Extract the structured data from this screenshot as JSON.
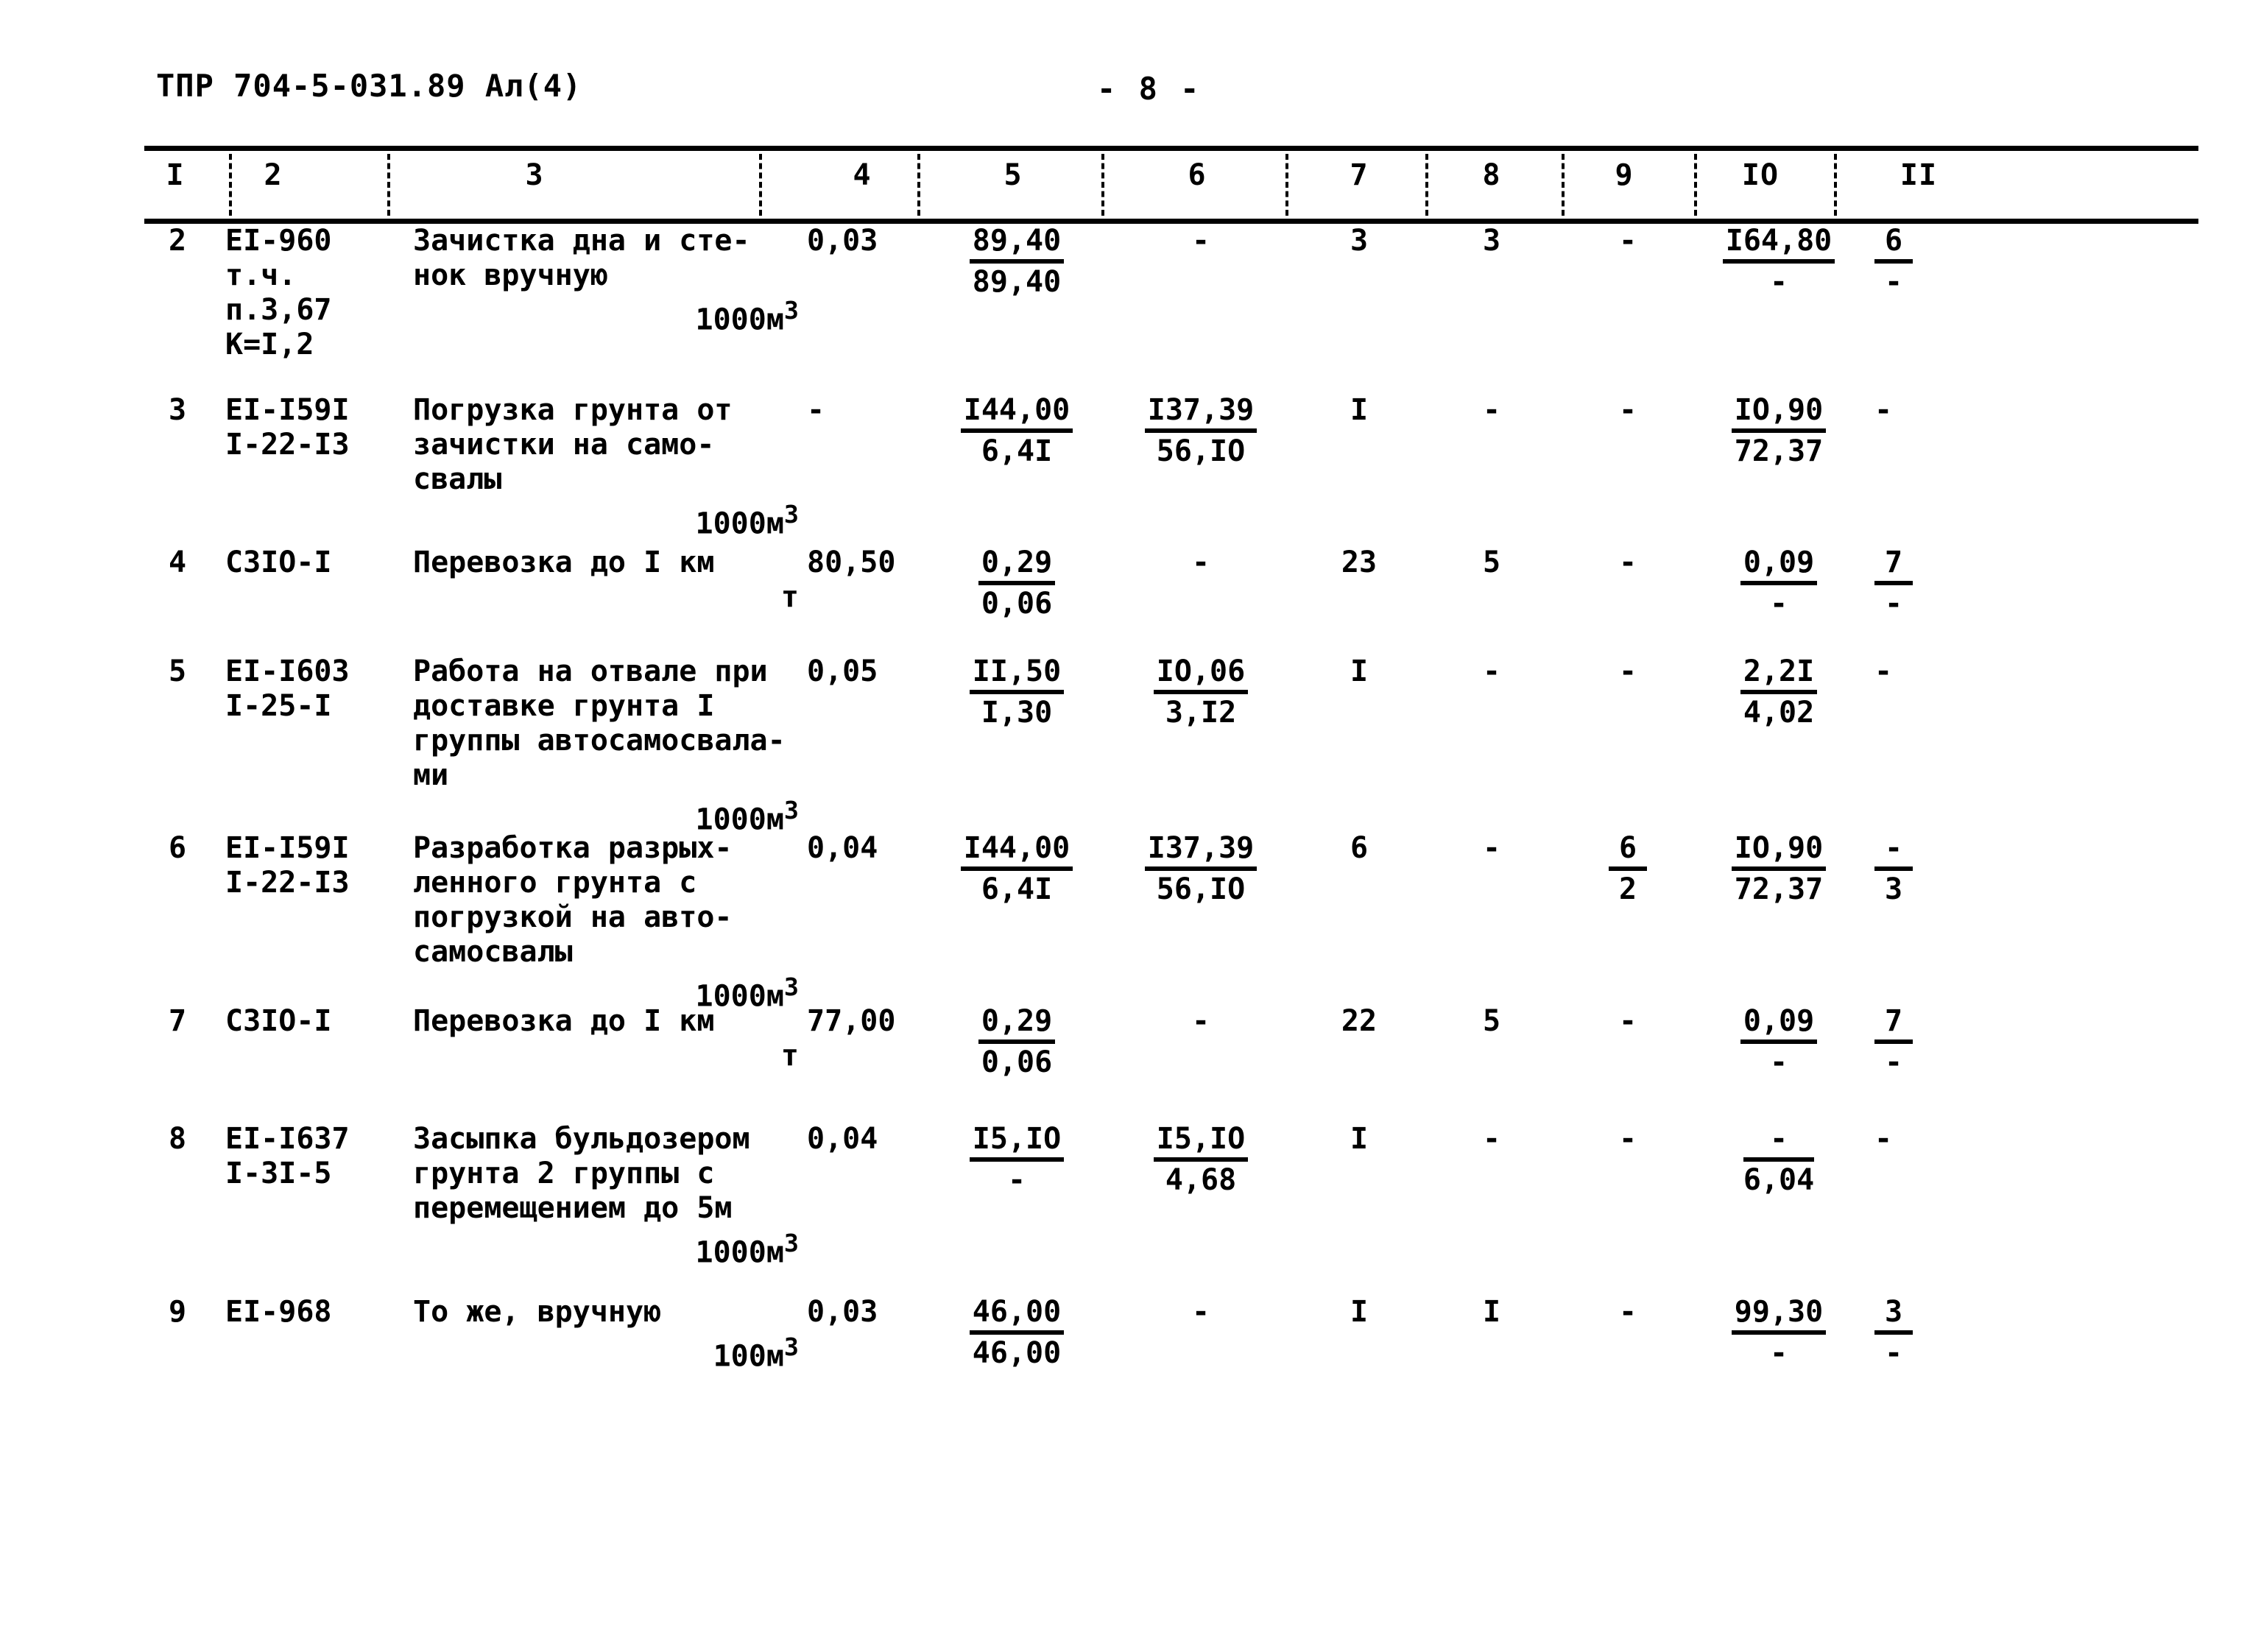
{
  "document": {
    "code": "ТПР 704-5-031.89 Ал(4)",
    "page_label": "- 8 -"
  },
  "table": {
    "column_headers": [
      "I",
      "2",
      "3",
      "4",
      "5",
      "6",
      "7",
      "8",
      "9",
      "IO",
      "II"
    ],
    "rows": [
      {
        "num": "2",
        "code_lines": [
          "EI-960",
          "т.ч.",
          "п.3,67",
          "К=I,2"
        ],
        "desc_lines": [
          "Зачистка дна и сте-",
          "нок вручную"
        ],
        "unit": "1000м",
        "unit_sup": "3",
        "col4": "0,03",
        "col5_num": "89,40",
        "col5_den": "89,40",
        "col6": "-",
        "col7": "3",
        "col8": "3",
        "col9": "-",
        "col10_num": "I64,80",
        "col10_den": "-",
        "col11_num": "6",
        "col11_den": "-"
      },
      {
        "num": "3",
        "code_lines": [
          "EI-I59I",
          "I-22-I3"
        ],
        "desc_lines": [
          "Погрузка грунта от",
          "зачистки на само-",
          "свалы"
        ],
        "unit": "1000м",
        "unit_sup": "3",
        "col4": "-",
        "col5_num": "I44,00",
        "col5_den": "6,4I",
        "col6_num": "I37,39",
        "col6_den": "56,IO",
        "col7": "I",
        "col8": "-",
        "col9": "-",
        "col10_num": "IO,90",
        "col10_den": "72,37",
        "col11": "-"
      },
      {
        "num": "4",
        "code_lines": [
          "C3IO-I"
        ],
        "desc_lines": [
          "Перевозка до I км"
        ],
        "unit": "т",
        "unit_sup": "",
        "col4": "80,50",
        "col5_num": "0,29",
        "col5_den": "0,06",
        "col6": "-",
        "col7": "23",
        "col8": "5",
        "col9": "-",
        "col10_num": "0,09",
        "col10_den": "-",
        "col11_num": "7",
        "col11_den": "-"
      },
      {
        "num": "5",
        "code_lines": [
          "EI-I603",
          "I-25-I"
        ],
        "desc_lines": [
          "Работа на отвале при",
          "доставке грунта I",
          "группы автосамосвала-",
          "ми"
        ],
        "unit": "1000м",
        "unit_sup": "3",
        "col4": "0,05",
        "col5_num": "II,50",
        "col5_den": "I,30",
        "col6_num": "IO,06",
        "col6_den": "3,I2",
        "col7": "I",
        "col8": "-",
        "col9": "-",
        "col10_num": "2,2I",
        "col10_den": "4,02",
        "col11": "-"
      },
      {
        "num": "6",
        "code_lines": [
          "EI-I59I",
          "I-22-I3"
        ],
        "desc_lines": [
          "Разработка разрых-",
          "ленного грунта с",
          "погрузкой на авто-",
          "самосвалы"
        ],
        "unit": "1000м",
        "unit_sup": "3",
        "col4": "0,04",
        "col5_num": "I44,00",
        "col5_den": "6,4I",
        "col6_num": "I37,39",
        "col6_den": "56,IO",
        "col7": "6",
        "col8": "-",
        "col9_num": "6",
        "col9_den": "2",
        "col10_num": "IO,90",
        "col10_den": "72,37",
        "col11_num": "-",
        "col11_den": "3"
      },
      {
        "num": "7",
        "code_lines": [
          "C3IO-I"
        ],
        "desc_lines": [
          "Перевозка до I км"
        ],
        "unit": "т",
        "unit_sup": "",
        "col4": "77,00",
        "col5_num": "0,29",
        "col5_den": "0,06",
        "col6": "-",
        "col7": "22",
        "col8": "5",
        "col9": "-",
        "col10_num": "0,09",
        "col10_den": "-",
        "col11_num": "7",
        "col11_den": "-"
      },
      {
        "num": "8",
        "code_lines": [
          "EI-I637",
          "I-3I-5"
        ],
        "desc_lines": [
          "Засыпка бульдозером",
          "грунта 2 группы с",
          "перемещением до 5м"
        ],
        "unit": "1000м",
        "unit_sup": "3",
        "col4": "0,04",
        "col5_num": "I5,IO",
        "col5_den": "-",
        "col6_num": "I5,IO",
        "col6_den": "4,68",
        "col7": "I",
        "col8": "-",
        "col9": "-",
        "col10_num": "-",
        "col10_den": "6,04",
        "col11": "-"
      },
      {
        "num": "9",
        "code_lines": [
          "EI-968"
        ],
        "desc_lines": [
          "То же, вручную"
        ],
        "unit": "100м",
        "unit_sup": "3",
        "col4": "0,03",
        "col5_num": "46,00",
        "col5_den": "46,00",
        "col6": "-",
        "col7": "I",
        "col8": "I",
        "col9": "-",
        "col10_num": "99,30",
        "col10_den": "-",
        "col11_num": "3",
        "col11_den": "-"
      }
    ]
  }
}
